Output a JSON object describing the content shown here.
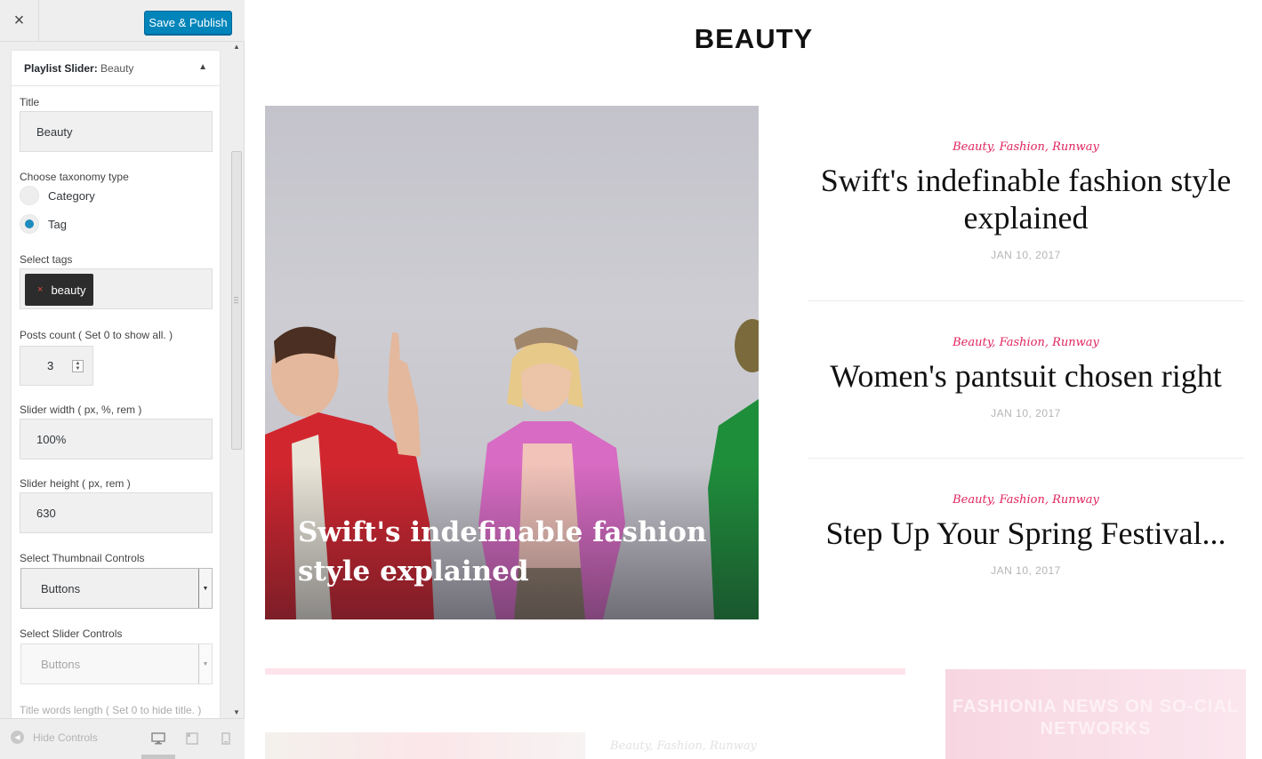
{
  "customizer": {
    "close_icon": "×",
    "save_button": "Save & Publish",
    "panel": {
      "title_strong": "Playlist Slider:",
      "title_sub": "Beauty",
      "collapse_icon": "▲"
    },
    "fields": {
      "title_label": "Title",
      "title_value": "Beauty",
      "taxonomy_label": "Choose taxonomy type",
      "taxonomy_options": [
        "Category",
        "Tag"
      ],
      "taxonomy_selected": "Tag",
      "tags_label": "Select tags",
      "tag_remove_icon": "×",
      "tag_chip": "beauty",
      "count_label": "Posts count ( Set 0 to show all. )",
      "count_value": "3",
      "width_label": "Slider width ( px, %, rem )",
      "width_value": "100%",
      "height_label": "Slider height ( px, rem )",
      "height_value": "630",
      "thumb_label": "Select Thumbnail Controls",
      "thumb_value": "Buttons",
      "slider_ctrl_label": "Select Slider Controls",
      "slider_ctrl_value": "Buttons",
      "words_label": "Title words length ( Set 0 to hide title. )"
    },
    "footer": {
      "hide_controls": "Hide Controls",
      "hide_icon": "◀",
      "desktop_icon": "🖥",
      "tablet_icon": "▭",
      "mobile_icon": "▯"
    }
  },
  "preview": {
    "section_title": "BEAUTY",
    "hero_title": "Swift's indefinable fashion style explained",
    "hero_dots": "•",
    "posts": [
      {
        "cats": "Beauty, Fashion, Runway",
        "title": "Swift's indefinable fashion style explained",
        "date": "JAN 10, 2017"
      },
      {
        "cats": "Beauty, Fashion, Runway",
        "title": "Women's pantsuit chosen right",
        "date": "JAN 10, 2017"
      },
      {
        "cats": "Beauty, Fashion, Runway",
        "title": "Step Up Your Spring Festival...",
        "date": "JAN 10, 2017"
      }
    ],
    "promo": "FASHIONIA NEWS ON SO-CIAL NETWORKS",
    "ghost_cats": "Beauty, Fashion, Runway"
  },
  "colors": {
    "accent": "#0085ba",
    "category_pink": "#e0245e",
    "radio_on": "#1e8cbe"
  }
}
